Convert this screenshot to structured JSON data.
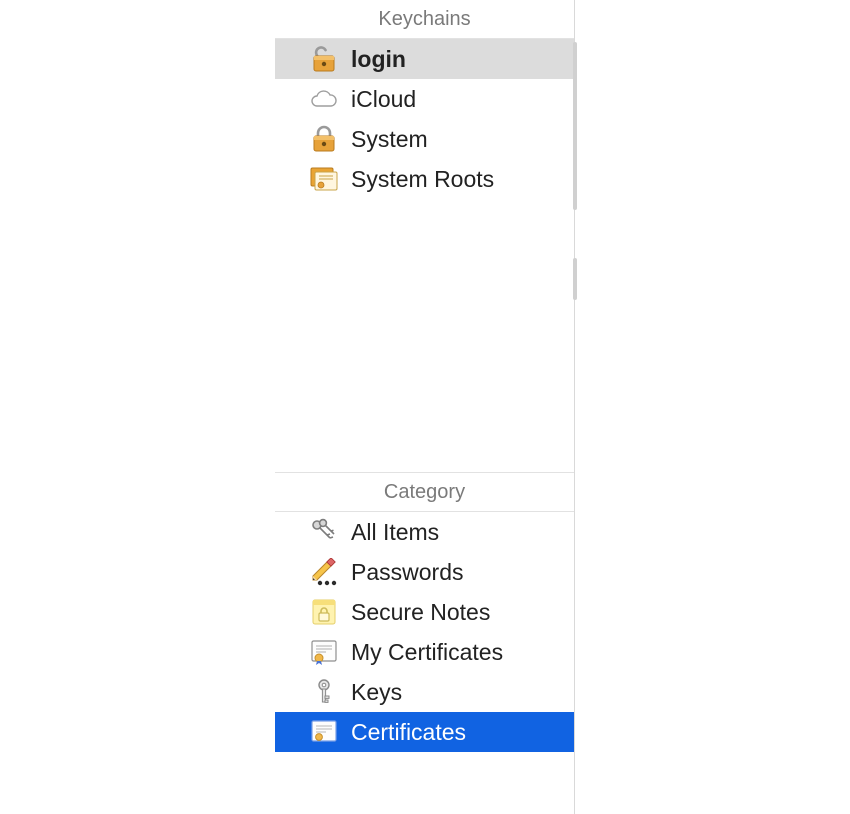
{
  "sidebar": {
    "keychains": {
      "header": "Keychains",
      "items": [
        {
          "label": "login",
          "icon": "unlocked-padlock-icon",
          "selected": "gray"
        },
        {
          "label": "iCloud",
          "icon": "cloud-icon",
          "selected": "none"
        },
        {
          "label": "System",
          "icon": "locked-padlock-icon",
          "selected": "none"
        },
        {
          "label": "System Roots",
          "icon": "cert-stack-icon",
          "selected": "none"
        }
      ]
    },
    "category": {
      "header": "Category",
      "items": [
        {
          "label": "All Items",
          "icon": "keys-icon",
          "selected": "none"
        },
        {
          "label": "Passwords",
          "icon": "pencil-dots-icon",
          "selected": "none"
        },
        {
          "label": "Secure Notes",
          "icon": "note-lock-icon",
          "selected": "none"
        },
        {
          "label": "My Certificates",
          "icon": "cert-badge-icon",
          "selected": "none"
        },
        {
          "label": "Keys",
          "icon": "single-key-icon",
          "selected": "none"
        },
        {
          "label": "Certificates",
          "icon": "cert-doc-icon",
          "selected": "blue"
        }
      ]
    }
  }
}
